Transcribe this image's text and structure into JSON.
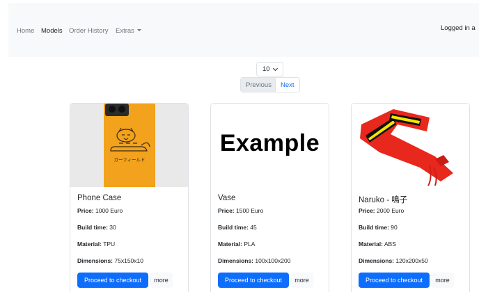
{
  "nav": {
    "items": [
      "Home",
      "Models",
      "Order History",
      "Extras"
    ],
    "active": "Models",
    "user_status": "Logged in a"
  },
  "pagination": {
    "per_page": "10",
    "previous": "Previous",
    "next": "Next"
  },
  "products": [
    {
      "name": "Phone Case",
      "price_label": "Price:",
      "price": "1000 Euro",
      "build_label": "Build time:",
      "build_time": "30",
      "material_label": "Material:",
      "material": "TPU",
      "dimensions_label": "Dimensions:",
      "dimensions": "75x150x10",
      "checkout": "Proceed to checkout",
      "more": "more",
      "image_text": "ガーフィールド"
    },
    {
      "name": "Vase",
      "price_label": "Price:",
      "price": "1500 Euro",
      "build_label": "Build time:",
      "build_time": "45",
      "material_label": "Material:",
      "material": "PLA",
      "dimensions_label": "Dimensions:",
      "dimensions": "100x100x200",
      "checkout": "Proceed to checkout",
      "more": "more",
      "image_text": "Example"
    },
    {
      "name": "Naruko - 鳴子",
      "price_label": "Price:",
      "price": "2000 Euro",
      "build_label": "Build time:",
      "build_time": "90",
      "material_label": "Material:",
      "material": "ABS",
      "dimensions_label": "Dimensions:",
      "dimensions": "120x200x50",
      "checkout": "Proceed to checkout",
      "more": "more"
    }
  ],
  "colors": {
    "primary": "#0d6efd",
    "navbar_bg": "#f8f9fa",
    "phone_case": "#f2a21c",
    "naruko_red": "#e8281c",
    "naruko_yellow": "#f5e400"
  }
}
